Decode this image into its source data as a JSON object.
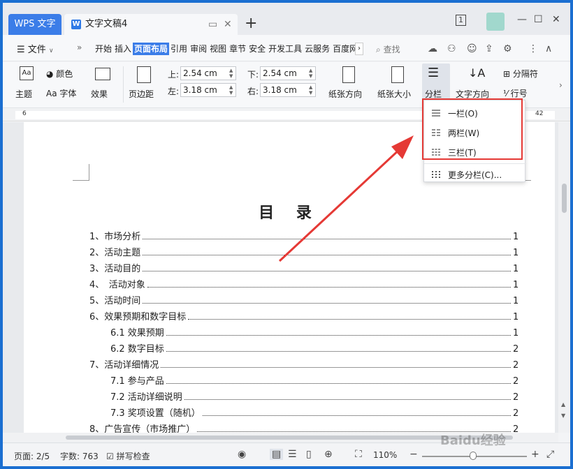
{
  "titlebar": {
    "app_tab": "WPS 文字",
    "doc_tab": "文字文稿4",
    "doc_icon": "W",
    "page_num_badge": "1"
  },
  "menu": {
    "file": "文件",
    "tabs": [
      "开始",
      "插入",
      "页面布局",
      "引用",
      "审阅",
      "视图",
      "章节",
      "安全",
      "开发工具",
      "云服务",
      "百度网"
    ],
    "active_tab": "页面布局",
    "search": "查找"
  },
  "ribbon": {
    "theme": "主题",
    "color": "颜色",
    "font": "Aa 字体",
    "effect": "效果",
    "margin": "页边距",
    "top_label": "上:",
    "bottom_label": "下:",
    "left_label": "左:",
    "right_label": "右:",
    "top_value": "2.54 cm",
    "bottom_value": "2.54 cm",
    "left_value": "3.18 cm",
    "right_value": "3.18 cm",
    "orientation": "纸张方向",
    "size": "纸张大小",
    "columns": "分栏",
    "text_direction": "文字方向",
    "separator": "分隔符",
    "line_number": "行号"
  },
  "ruler": {
    "left": "6",
    "right": "42"
  },
  "dropdown": {
    "items": [
      "一栏(O)",
      "两栏(W)",
      "三栏(T)",
      "更多分栏(C)..."
    ]
  },
  "document": {
    "title": "目 录",
    "toc": [
      {
        "text": "1、市场分析",
        "page": "1",
        "indent": 0
      },
      {
        "text": "2、活动主题",
        "page": "1",
        "indent": 0
      },
      {
        "text": "3、活动目的",
        "page": "1",
        "indent": 0
      },
      {
        "text": "4、　活动对象",
        "page": "1",
        "indent": 0
      },
      {
        "text": "5、活动时间",
        "page": "1",
        "indent": 0
      },
      {
        "text": "6、效果预期和数字目标",
        "page": "1",
        "indent": 0
      },
      {
        "text": "6.1 效果预期",
        "page": "1",
        "indent": 1
      },
      {
        "text": "6.2 数字目标",
        "page": "2",
        "indent": 1
      },
      {
        "text": "7、活动详细情况",
        "page": "2",
        "indent": 0
      },
      {
        "text": "7.1 参与产品",
        "page": "2",
        "indent": 1
      },
      {
        "text": "7.2 活动详细说明",
        "page": "2",
        "indent": 1
      },
      {
        "text": "7.3 奖项设置（随机）",
        "page": "2",
        "indent": 1
      },
      {
        "text": "8、广告宣传（市场推广）",
        "page": "2",
        "indent": 0
      }
    ]
  },
  "status": {
    "page": "页面: 2/5",
    "words": "字数: 763",
    "spell": "拼写检查",
    "zoom": "110%"
  },
  "watermark": "Baidu经验",
  "colors": {
    "accent": "#3b7de8",
    "highlight": "#e53935"
  }
}
